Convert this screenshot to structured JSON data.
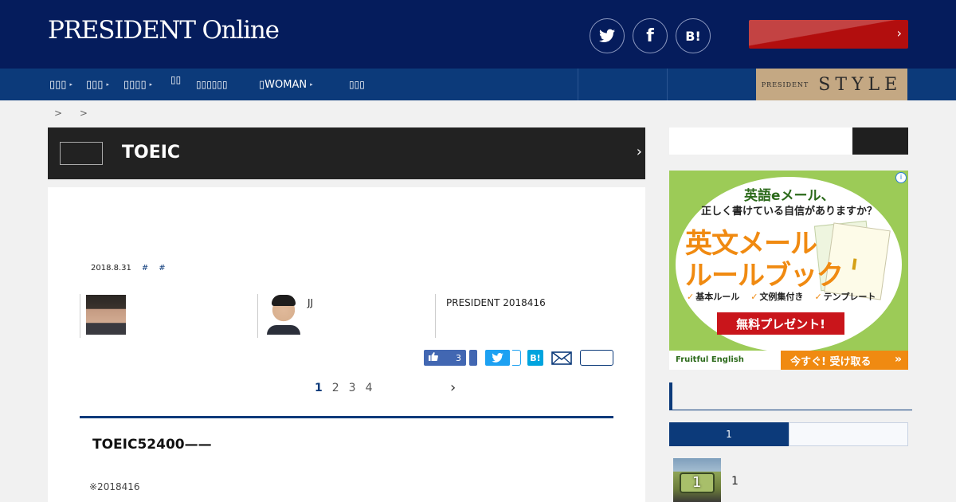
{
  "header": {
    "logo": "PRESIDENT Online",
    "social": {
      "twitter": "🐦",
      "facebook": "f",
      "hatena": "B!"
    },
    "premium_chevron": "›"
  },
  "nav": {
    "items": [
      {
        "label": "▯▯▯",
        "arrow": "▸"
      },
      {
        "label": "▯▯▯",
        "arrow": "▸"
      },
      {
        "label": "▯▯▯▯",
        "arrow": "▸"
      },
      {
        "label": "▯▯",
        "arrow": ""
      },
      {
        "label": "▯▯▯▯▯▯",
        "arrow": ""
      },
      {
        "label": "▯WOMAN",
        "arrow": "▸"
      },
      {
        "label": "▯▯▯",
        "arrow": ""
      }
    ],
    "style_banner": {
      "small": "PRESIDENT",
      "big": "STYLE"
    }
  },
  "breadcrumb": [
    ">",
    ">"
  ],
  "series": {
    "title": "TOEIC",
    "chevron": "›"
  },
  "article": {
    "date": "2018.8.31",
    "tags": [
      "#",
      "#"
    ],
    "authors": [
      {
        "name": ""
      },
      {
        "name": "JJ"
      },
      {
        "name": "PRESIDENT 2018416"
      }
    ],
    "share": {
      "like_count": "3",
      "hatena": "B!",
      "mail": "✉"
    },
    "pager": {
      "pages": [
        "1",
        "2",
        "3",
        "4"
      ],
      "current": "1",
      "next": "›"
    },
    "headline": "TOEIC52400——",
    "note": "※2018416"
  },
  "sidebar": {
    "ad": {
      "info": "i",
      "line1": "英語eメール、",
      "line2": "正しく書けている自信がありますか？",
      "big1": "英文メール",
      "big2": "ルールブック",
      "features": [
        "基本ルール",
        "文例集付き",
        "テンプレート"
      ],
      "ribbon": "無料プレゼント!",
      "brand": "Fruitful English",
      "cta": "今すぐ! 受け取る",
      "cta_arrow": "»"
    },
    "ranking": {
      "tab1": "1",
      "item_rank": "1",
      "item_label": "1"
    }
  }
}
